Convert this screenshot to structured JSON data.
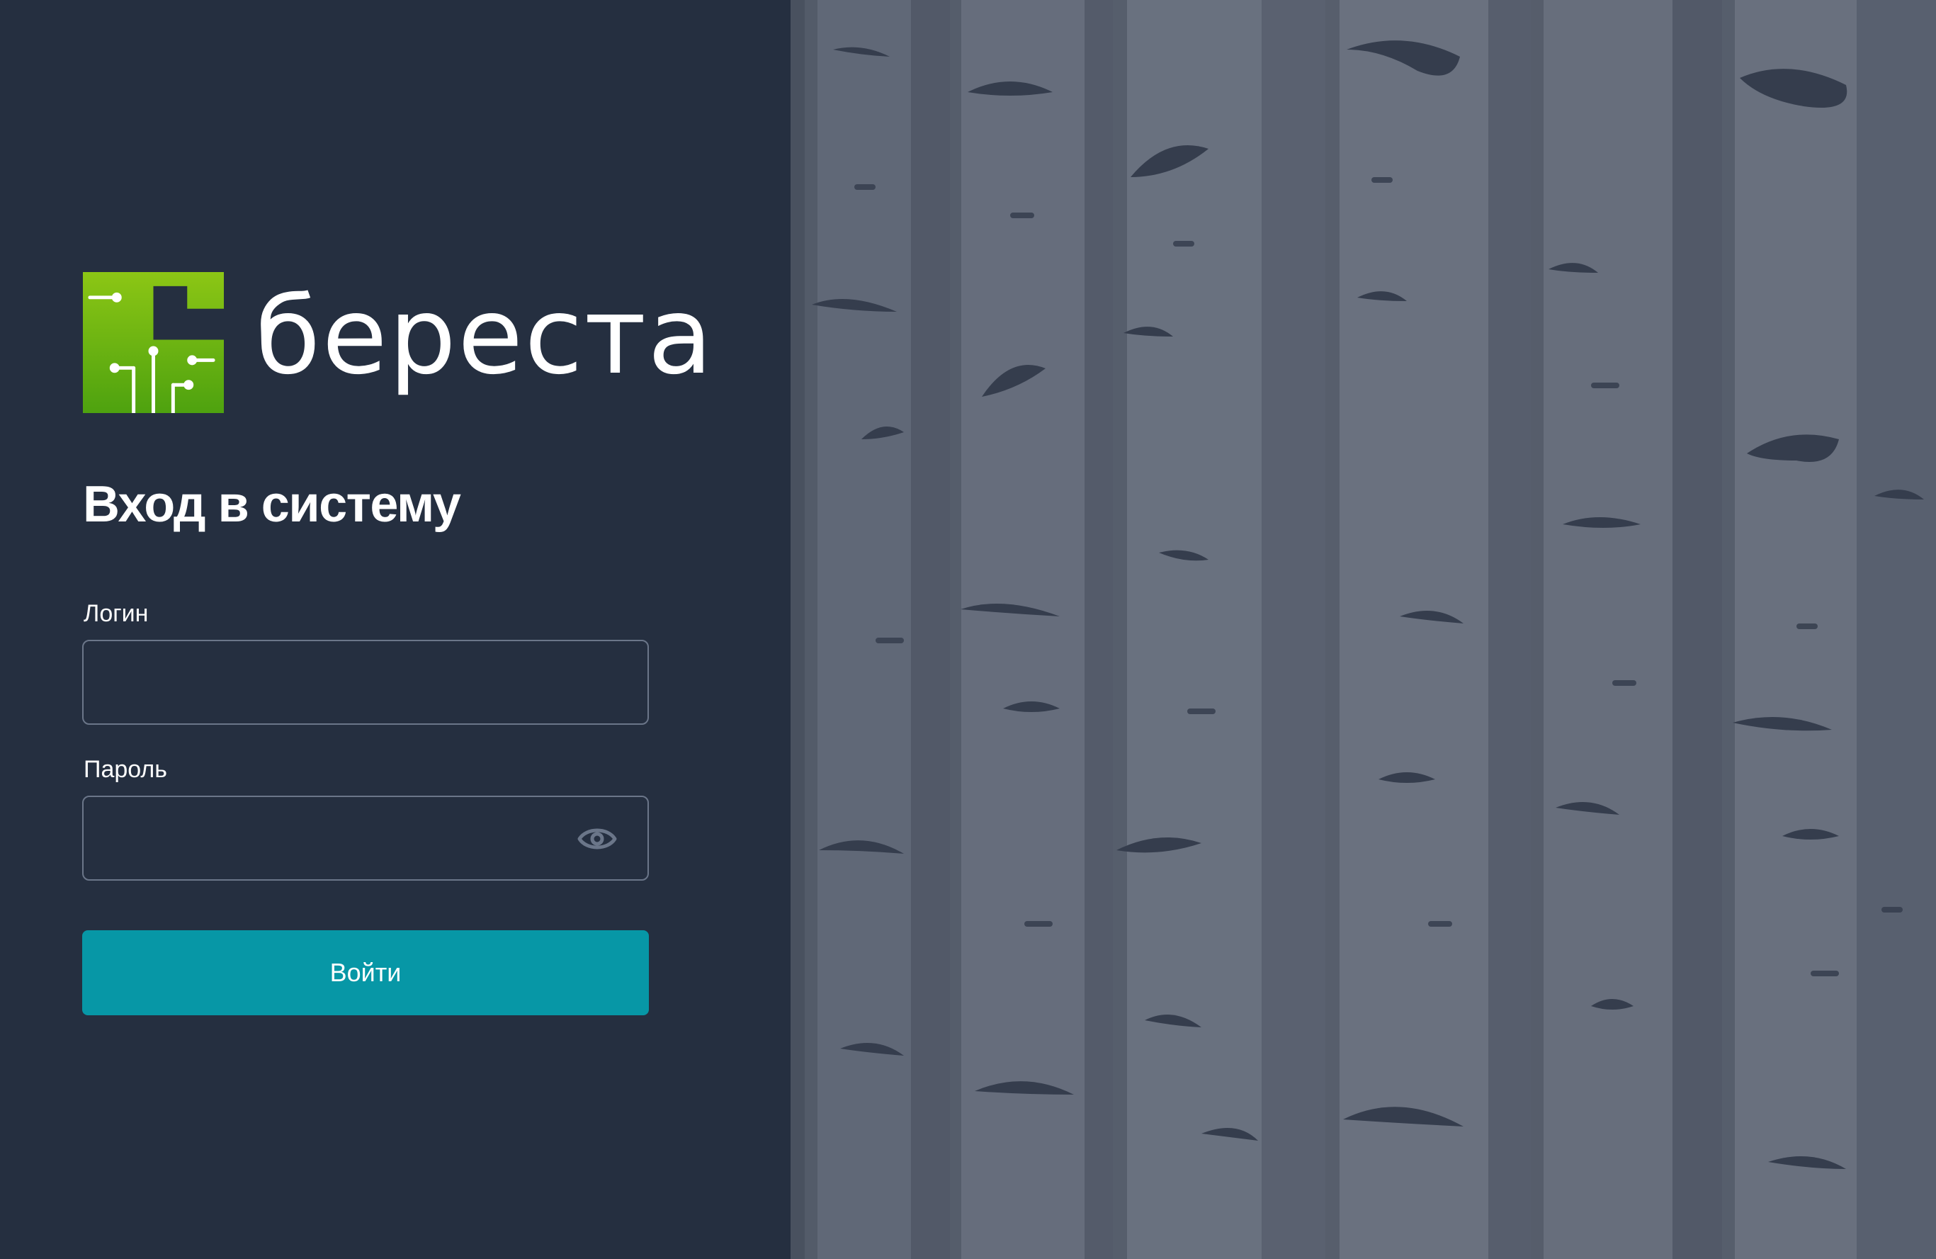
{
  "brand": {
    "name": "береста",
    "colors": {
      "accent_green": "#7fbf1a",
      "panel_bg": "#252f40",
      "button": "#0797a6"
    }
  },
  "login_form": {
    "title": "Вход в систему",
    "login_label": "Логин",
    "login_value": "",
    "password_label": "Пароль",
    "password_value": "",
    "show_password_icon": "eye-icon",
    "submit_label": "Войти"
  },
  "background": {
    "description_icon": "birch-trees-image"
  }
}
